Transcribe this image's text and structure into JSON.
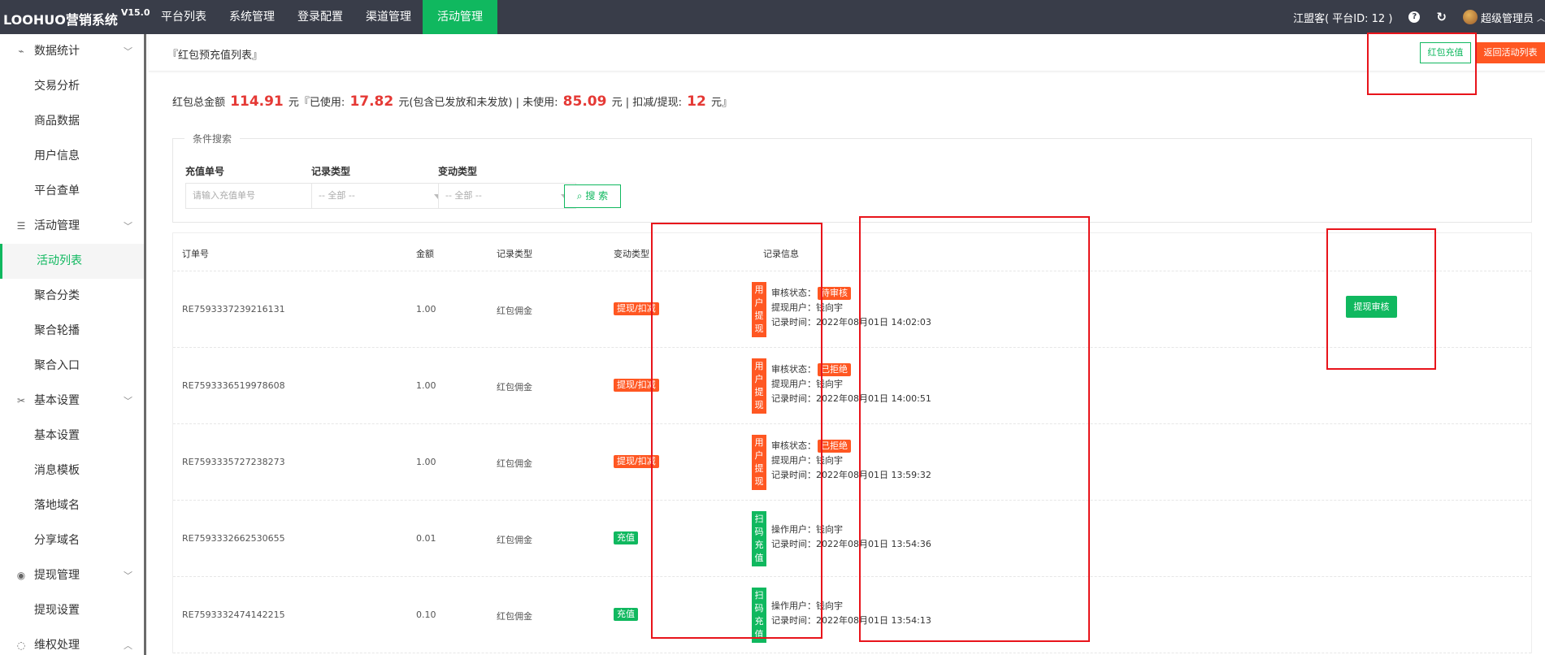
{
  "app": {
    "title": "LOOHUO营销系统",
    "version": "V15.0"
  },
  "topnav": [
    "平台列表",
    "系统管理",
    "登录配置",
    "渠道管理",
    "活动管理"
  ],
  "topright": {
    "platform": "江盟客( 平台ID: 12 )",
    "help_icon": "?",
    "refresh_icon": "↻",
    "user": "超级管理员"
  },
  "sidebar": {
    "groups": [
      {
        "icon": "pulse-icon",
        "glyph": "⌁",
        "label": "数据统计",
        "items": [
          "交易分析",
          "商品数据",
          "用户信息",
          "平台查单"
        ]
      },
      {
        "icon": "list-icon",
        "glyph": "☰",
        "label": "活动管理",
        "items": [
          "活动列表",
          "聚合分类",
          "聚合轮播",
          "聚合入口"
        ]
      },
      {
        "icon": "tools-icon",
        "glyph": "✂",
        "label": "基本设置",
        "items": [
          "基本设置",
          "消息模板",
          "落地域名",
          "分享域名"
        ]
      },
      {
        "icon": "coin-icon",
        "glyph": "◉",
        "label": "提现管理",
        "items": [
          "提现设置"
        ]
      },
      {
        "icon": "chat-icon",
        "glyph": "◌",
        "label": "维权处理",
        "items": []
      }
    ],
    "active_item": "活动列表"
  },
  "header": {
    "breadcrumb": "『红包预充值列表』",
    "recharge_button": "红包充值",
    "back_button": "返回活动列表"
  },
  "summary": {
    "prefix": "红包总金额",
    "total": "114.91",
    "used_label": "元『已使用:",
    "used": "17.82",
    "unused_label": "元(包含已发放和未发放) | 未使用:",
    "unused": "85.09",
    "deduct_label": "元 | 扣减/提现:",
    "deduct": "12",
    "suffix": "元』"
  },
  "search": {
    "legend": "条件搜索",
    "fields": [
      {
        "label": "充值单号",
        "placeholder": "请输入充值单号"
      },
      {
        "label": "记录类型",
        "value": "-- 全部 --"
      },
      {
        "label": "变动类型",
        "value": "-- 全部 --"
      }
    ],
    "button": "搜 索",
    "search_icon": "⌕"
  },
  "table": {
    "headers": [
      "订单号",
      "金额",
      "记录类型",
      "变动类型",
      "记录信息"
    ],
    "rows": [
      {
        "order": "RE7593337239216131",
        "amount": "1.00",
        "type": "红包佣金",
        "change": "提现/扣减",
        "change_color": "orange",
        "tag": "用户提现",
        "tag_color": "orange",
        "lines": [
          {
            "label": "审核状态：",
            "badge": "待审核"
          },
          {
            "label": "提现用户：钱向宇"
          },
          {
            "label": "记录时间：2022年08月01日 14:02:03"
          }
        ],
        "action": "提现审核"
      },
      {
        "order": "RE7593336519978608",
        "amount": "1.00",
        "type": "红包佣金",
        "change": "提现/扣减",
        "change_color": "orange",
        "tag": "用户提现",
        "tag_color": "orange",
        "lines": [
          {
            "label": "审核状态：",
            "badge": "已拒绝"
          },
          {
            "label": "提现用户：钱向宇"
          },
          {
            "label": "记录时间：2022年08月01日 14:00:51"
          }
        ],
        "action": ""
      },
      {
        "order": "RE7593335727238273",
        "amount": "1.00",
        "type": "红包佣金",
        "change": "提现/扣减",
        "change_color": "orange",
        "tag": "用户提现",
        "tag_color": "orange",
        "lines": [
          {
            "label": "审核状态：",
            "badge": "已拒绝"
          },
          {
            "label": "提现用户：钱向宇"
          },
          {
            "label": "记录时间：2022年08月01日 13:59:32"
          }
        ],
        "action": ""
      },
      {
        "order": "RE7593332662530655",
        "amount": "0.01",
        "type": "红包佣金",
        "change": "充值",
        "change_color": "green",
        "tag": "扫码充值",
        "tag_color": "green",
        "lines": [
          {
            "label": "操作用户：钱向宇"
          },
          {
            "label": "记录时间：2022年08月01日 13:54:36"
          }
        ],
        "action": ""
      },
      {
        "order": "RE7593332474142215",
        "amount": "0.10",
        "type": "红包佣金",
        "change": "充值",
        "change_color": "green",
        "tag": "扫码充值",
        "tag_color": "green",
        "lines": [
          {
            "label": "操作用户：钱向宇"
          },
          {
            "label": "记录时间：2022年08月01日 13:54:13"
          }
        ],
        "action": ""
      }
    ]
  },
  "colors": {
    "accent": "#10b85f",
    "warning": "#ff5722",
    "highlight": "#e8141b",
    "topbar": "#393d49"
  }
}
